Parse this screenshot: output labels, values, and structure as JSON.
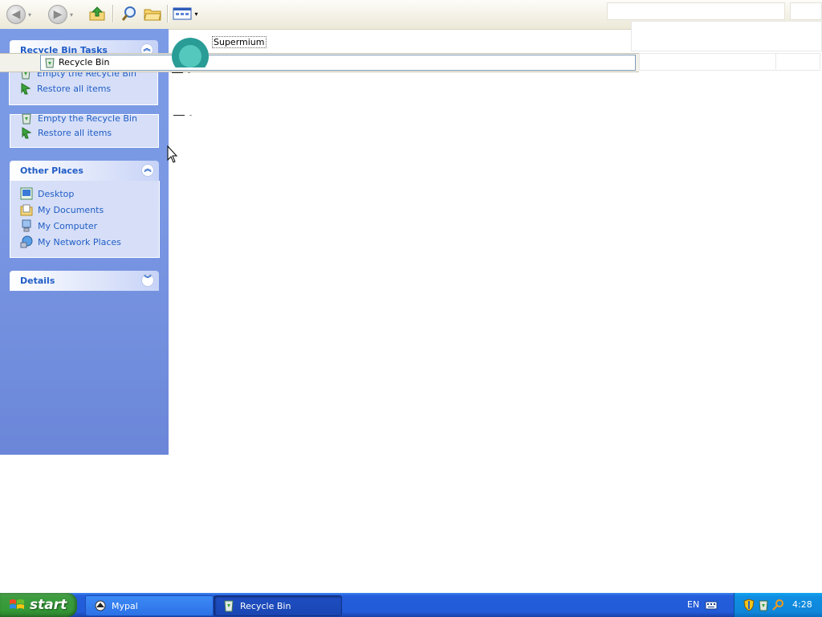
{
  "address": {
    "text": "Recycle Bin"
  },
  "tasks_panel": {
    "title": "Recycle Bin Tasks",
    "items": [
      {
        "label": "Empty the Recycle Bin",
        "icon": "empty-recycle-bin-icon"
      },
      {
        "label": "Restore all items",
        "icon": "restore-icon"
      }
    ]
  },
  "tasks_panel_ghost": {
    "items": [
      {
        "label": "Empty the Recycle Bin"
      },
      {
        "label": "Restore all items"
      }
    ]
  },
  "other_places": {
    "title": "Other Places",
    "items": [
      {
        "label": "Desktop",
        "icon": "desktop-icon"
      },
      {
        "label": "My Documents",
        "icon": "my-documents-icon"
      },
      {
        "label": "My Computer",
        "icon": "my-computer-icon"
      },
      {
        "label": "My Network Places",
        "icon": "my-network-places-icon"
      }
    ]
  },
  "details": {
    "title": "Details"
  },
  "content": {
    "item_name": "Supermium"
  },
  "taskbar": {
    "start_label": "start",
    "buttons": [
      {
        "label": "Mypal",
        "active": false
      },
      {
        "label": "Recycle Bin",
        "active": true
      }
    ],
    "language": "EN",
    "clock": "4:28"
  },
  "colors": {
    "link": "#215dc6",
    "pane_bg": "#7a98e4",
    "taskbar": "#245edb",
    "start": "#3c9c3f"
  }
}
